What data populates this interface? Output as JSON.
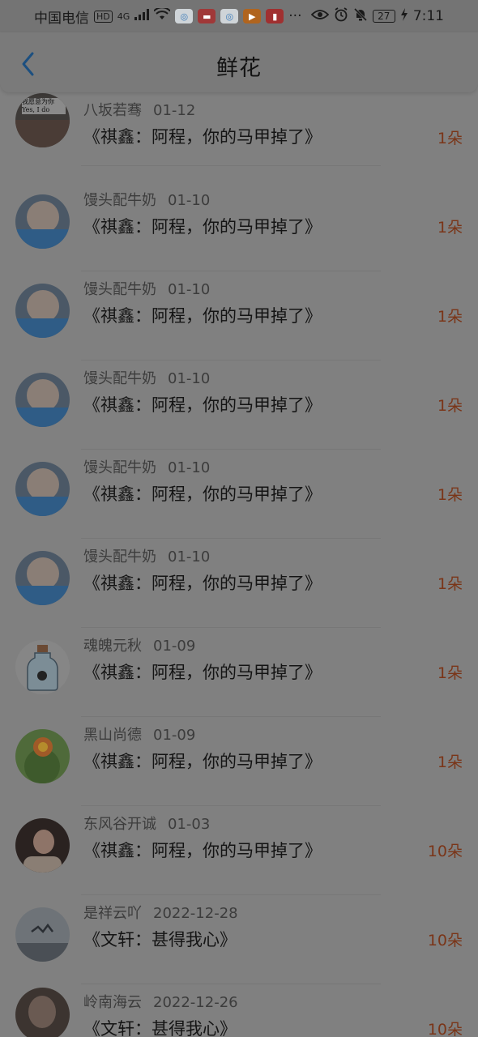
{
  "status_bar": {
    "carrier": "中国电信",
    "hd": "HD",
    "network": "4G",
    "icons": [
      "signal-icon",
      "wifi-icon",
      "app-icon-1",
      "app-icon-2",
      "app-icon-3",
      "app-icon-4",
      "app-icon-5",
      "more-icon",
      "eye-icon",
      "alarm-icon",
      "mute-icon",
      "battery-icon",
      "charging-icon"
    ],
    "more": "···",
    "battery": "27",
    "time": "7:11"
  },
  "header": {
    "back_icon": "chevron-left-icon",
    "title": "鲜花"
  },
  "list": [
    {
      "name": "八坂若骞",
      "date": "01-12",
      "title": "《祺鑫：阿程，你的马甲掉了》",
      "count": "1朵",
      "avatar_text": "我愿意为你 Yes, I do"
    },
    {
      "name": "馒头配牛奶",
      "date": "01-10",
      "title": "《祺鑫：阿程，你的马甲掉了》",
      "count": "1朵"
    },
    {
      "name": "馒头配牛奶",
      "date": "01-10",
      "title": "《祺鑫：阿程，你的马甲掉了》",
      "count": "1朵"
    },
    {
      "name": "馒头配牛奶",
      "date": "01-10",
      "title": "《祺鑫：阿程，你的马甲掉了》",
      "count": "1朵"
    },
    {
      "name": "馒头配牛奶",
      "date": "01-10",
      "title": "《祺鑫：阿程，你的马甲掉了》",
      "count": "1朵"
    },
    {
      "name": "馒头配牛奶",
      "date": "01-10",
      "title": "《祺鑫：阿程，你的马甲掉了》",
      "count": "1朵"
    },
    {
      "name": "魂魄元秋",
      "date": "01-09",
      "title": "《祺鑫：阿程，你的马甲掉了》",
      "count": "1朵"
    },
    {
      "name": "黑山尚德",
      "date": "01-09",
      "title": "《祺鑫：阿程，你的马甲掉了》",
      "count": "1朵"
    },
    {
      "name": "东风谷开诚",
      "date": "01-03",
      "title": "《祺鑫：阿程，你的马甲掉了》",
      "count": "10朵"
    },
    {
      "name": "是祥云吖",
      "date": "2022-12-28",
      "title": "《文轩：甚得我心》",
      "count": "10朵"
    },
    {
      "name": "岭南海云",
      "date": "2022-12-26",
      "title": "《文轩：甚得我心》",
      "count": "10朵"
    }
  ]
}
